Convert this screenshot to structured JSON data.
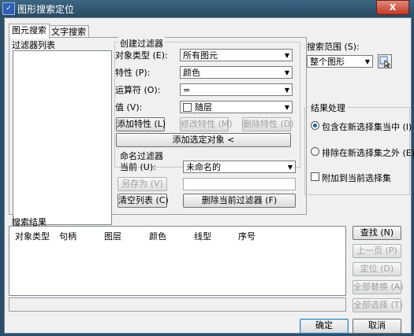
{
  "window": {
    "title": "图形搜索定位",
    "close_label": "X"
  },
  "tabs": [
    {
      "label": "图元搜索",
      "active": true
    },
    {
      "label": "文字搜索",
      "active": false
    }
  ],
  "filter_list": {
    "label": "过滤器列表"
  },
  "create_filter": {
    "legend": "创建过滤器",
    "object_type_label": "对象类型 (E):",
    "object_type_value": "所有图元",
    "property_label": "特性 (P):",
    "property_value": "颜色",
    "operator_label": "运算符 (O):",
    "operator_value": "=",
    "value_label": "值 (V):",
    "value_value": "随层",
    "add_property": "添加特性 (L)",
    "modify_property": "修改特性 (M)",
    "delete_property": "删除特性 (D)",
    "add_selected": "添加选定对象 <"
  },
  "name_filter": {
    "legend": "命名过滤器",
    "current_label": "当前 (U):",
    "current_value": "未命名的",
    "save_as": "另存为 (V)",
    "clear_list": "清空列表 (C)",
    "delete_current": "删除当前过滤器 (F)"
  },
  "search_scope": {
    "label": "搜索范围 (S):",
    "value": "整个图形"
  },
  "result_processing": {
    "legend": "结果处理",
    "include_new": "包含在新选择集当中 (I)",
    "exclude_new": "排除在新选择集之外 (E)",
    "append_current": "附加到当前选择集"
  },
  "search_results": {
    "label": "搜索结果",
    "columns": [
      "对象类型",
      "句柄",
      "图层",
      "颜色",
      "线型",
      "序号"
    ]
  },
  "side_buttons": {
    "find": "查找 (N)",
    "prev": "上一页 (P)",
    "locate": "定位 (D)",
    "replace_all": "全部替换 (A)",
    "select_all": "全部选择 (T)"
  },
  "footer": {
    "ok": "确定",
    "cancel": "取消"
  }
}
